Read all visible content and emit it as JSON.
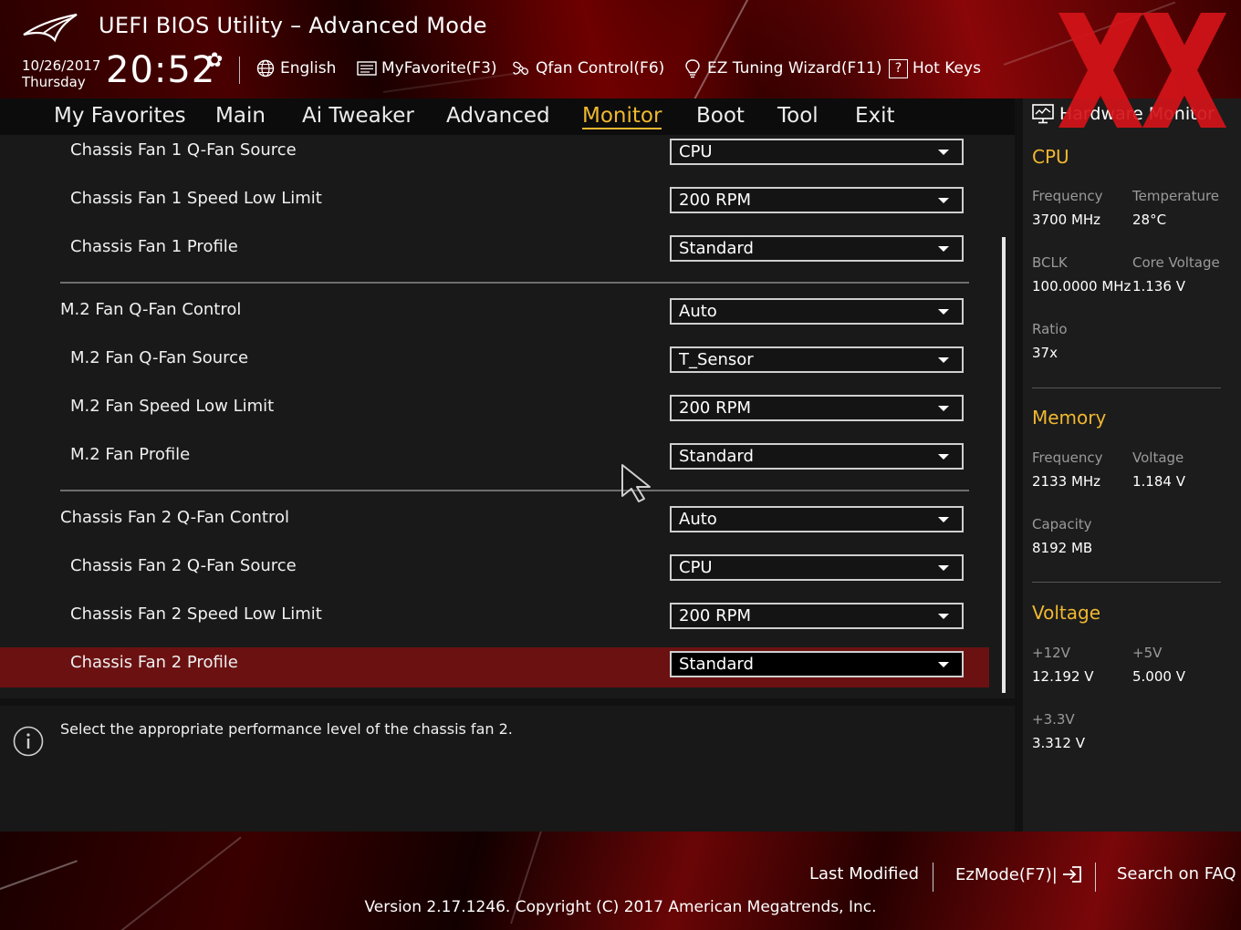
{
  "header": {
    "title": "UEFI BIOS Utility – Advanced Mode",
    "date": "10/26/2017",
    "day": "Thursday",
    "time": "20:52",
    "toolbar": [
      {
        "label": "English",
        "icon": "globe-icon"
      },
      {
        "label": "MyFavorite(F3)",
        "icon": "favorite-icon"
      },
      {
        "label": "Qfan Control(F6)",
        "icon": "fan-icon"
      },
      {
        "label": "EZ Tuning Wizard(F11)",
        "icon": "lightbulb-icon"
      },
      {
        "label": "Hot Keys",
        "icon": "help-icon",
        "icon_text": "?"
      }
    ]
  },
  "menu": {
    "tabs": [
      {
        "label": "My Favorites"
      },
      {
        "label": "Main"
      },
      {
        "label": "Ai Tweaker"
      },
      {
        "label": "Advanced"
      },
      {
        "label": "Monitor",
        "active": true
      },
      {
        "label": "Boot"
      },
      {
        "label": "Tool"
      },
      {
        "label": "Exit"
      }
    ]
  },
  "settings": {
    "rows": [
      {
        "label": "Chassis Fan 1 Q-Fan Source",
        "value": "CPU"
      },
      {
        "label": "Chassis Fan 1 Speed Low Limit",
        "value": "200 RPM"
      },
      {
        "label": "Chassis Fan 1 Profile",
        "value": "Standard"
      },
      {
        "label": "M.2 Fan Q-Fan Control",
        "value": "Auto"
      },
      {
        "label": "M.2 Fan Q-Fan Source",
        "value": "T_Sensor"
      },
      {
        "label": "M.2 Fan Speed Low Limit",
        "value": "200 RPM"
      },
      {
        "label": "M.2 Fan Profile",
        "value": "Standard"
      },
      {
        "label": "Chassis Fan 2 Q-Fan Control",
        "value": "Auto"
      },
      {
        "label": "Chassis Fan 2 Q-Fan Source",
        "value": "CPU"
      },
      {
        "label": "Chassis Fan 2 Speed Low Limit",
        "value": "200 RPM"
      },
      {
        "label": "Chassis Fan 2 Profile",
        "value": "Standard",
        "selected": true
      }
    ]
  },
  "help": {
    "text": "Select the appropriate performance level of the chassis fan 2."
  },
  "hardware_monitor": {
    "title": "Hardware Monitor",
    "cpu": {
      "heading": "CPU",
      "frequency_label": "Frequency",
      "frequency": "3700 MHz",
      "temperature_label": "Temperature",
      "temperature": "28°C",
      "bclk_label": "BCLK",
      "bclk": "100.0000 MHz",
      "core_voltage_label": "Core Voltage",
      "core_voltage": "1.136 V",
      "ratio_label": "Ratio",
      "ratio": "37x"
    },
    "memory": {
      "heading": "Memory",
      "frequency_label": "Frequency",
      "frequency": "2133 MHz",
      "voltage_label": "Voltage",
      "voltage": "1.184 V",
      "capacity_label": "Capacity",
      "capacity": "8192 MB"
    },
    "voltage": {
      "heading": "Voltage",
      "v12_label": "+12V",
      "v12": "12.192 V",
      "v5_label": "+5V",
      "v5": "5.000 V",
      "v33_label": "+3.3V",
      "v33": "3.312 V"
    }
  },
  "footer": {
    "last_modified": "Last Modified",
    "ezmode": "EzMode(F7)|",
    "search_faq": "Search on FAQ",
    "version": "Version 2.17.1246. Copyright (C) 2017 American Megatrends, Inc."
  },
  "colors": {
    "accent": "#f0b830",
    "selected_row": "#6b1112",
    "watermark": "#d41419"
  }
}
